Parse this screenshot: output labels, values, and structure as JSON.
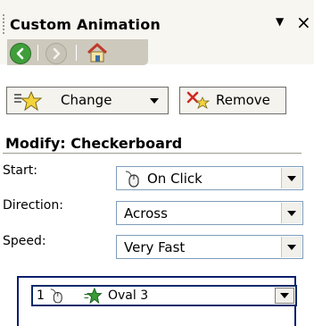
{
  "panel": {
    "title": "Custom Animation",
    "menu_glyph": "▼",
    "close_glyph": "×"
  },
  "nav": {
    "back_icon": "back-arrow-icon",
    "forward_icon": "forward-arrow-icon",
    "home_icon": "home-icon"
  },
  "toolbar": {
    "change_label": "Change",
    "remove_label": "Remove"
  },
  "modify": {
    "heading": "Modify: Checkerboard",
    "start_label": "Start:",
    "start_value": "On Click",
    "direction_label": "Direction:",
    "direction_value": "Across",
    "speed_label": "Speed:",
    "speed_value": "Very Fast"
  },
  "animation_list": {
    "items": [
      {
        "order": "1",
        "trigger_icon": "mouse-icon",
        "effect_icon": "entrance-star-icon",
        "name": "Oval 3"
      }
    ]
  },
  "colors": {
    "panel_bg": "#f7f6f1",
    "nav_group": "#cdc9bd",
    "back_green": "#3f9e3a",
    "list_border": "#0b1e6e",
    "combo_border": "#7f9db9"
  }
}
